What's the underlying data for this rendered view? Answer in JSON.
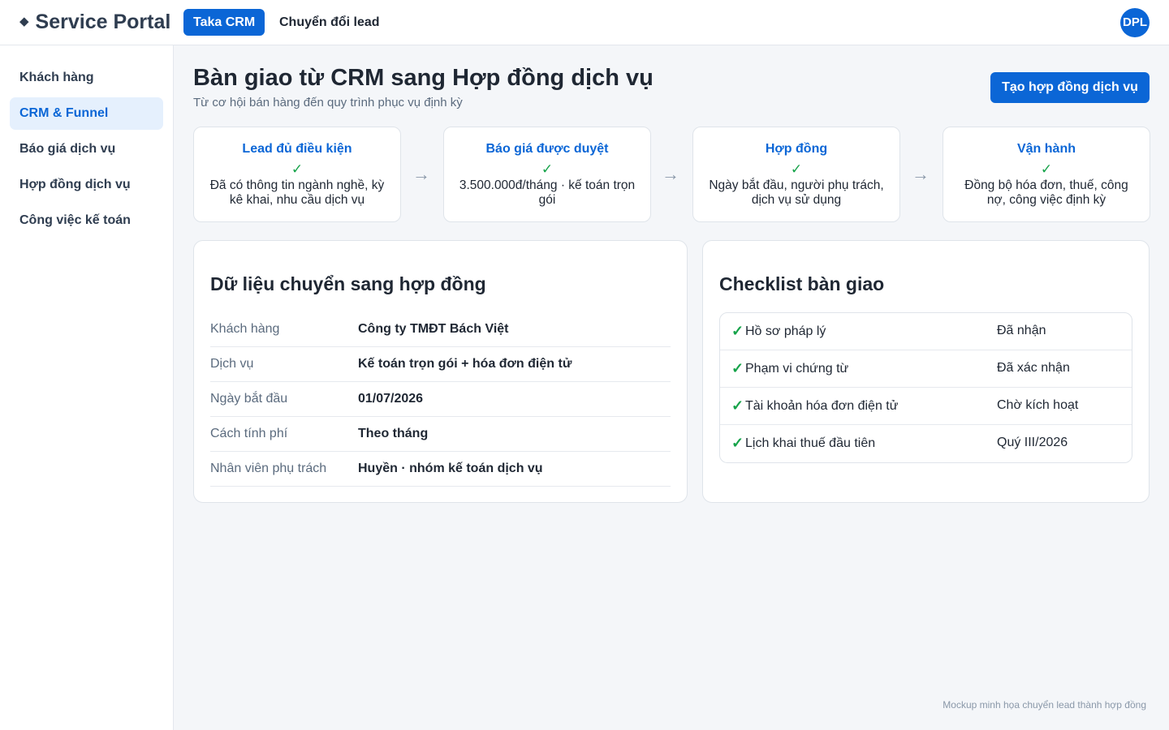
{
  "header": {
    "brand_icon": "diamond-icon",
    "brand_name": "Service Portal",
    "tabs": [
      {
        "label": "Taka CRM",
        "active": true
      },
      {
        "label": "Chuyển đổi lead",
        "active": false
      }
    ],
    "avatar_initials": "DPL"
  },
  "sidebar": {
    "items": [
      {
        "label": "Khách hàng",
        "active": false
      },
      {
        "label": "CRM & Funnel",
        "active": true
      },
      {
        "label": "Báo giá dịch vụ",
        "active": false
      },
      {
        "label": "Hợp đồng dịch vụ",
        "active": false
      },
      {
        "label": "Công việc kế toán",
        "active": false
      }
    ]
  },
  "main": {
    "title": "Bàn giao từ CRM sang Hợp đồng dịch vụ",
    "subtitle": "Từ cơ hội bán hàng đến quy trình phục vụ định kỳ",
    "primary_button": "Tạo hợp đồng dịch vụ",
    "steps": [
      {
        "title": "Lead đủ điều kiện",
        "check": "✓",
        "desc": "Đã có thông tin ngành nghề, kỳ kê khai, nhu cầu dịch vụ"
      },
      {
        "title": "Báo giá được duyệt",
        "check": "✓",
        "desc": "3.500.000đ/tháng · kế toán trọn gói"
      },
      {
        "title": "Hợp đồng",
        "check": "✓",
        "desc": "Ngày bắt đầu, người phụ trách, dịch vụ sử dụng"
      },
      {
        "title": "Vận hành",
        "check": "✓",
        "desc": "Đồng bộ hóa đơn, thuế, công nợ, công việc định kỳ"
      }
    ],
    "arrow": "→",
    "transfer_card": {
      "title": "Dữ liệu chuyển sang hợp đồng",
      "rows": [
        {
          "label": "Khách hàng",
          "value": "Công ty TMĐT Bách Việt"
        },
        {
          "label": "Dịch vụ",
          "value": "Kế toán trọn gói + hóa đơn điện tử"
        },
        {
          "label": "Ngày bắt đầu",
          "value": "01/07/2026"
        },
        {
          "label": "Cách tính phí",
          "value": "Theo tháng"
        },
        {
          "label": "Nhân viên phụ trách",
          "value": "Huyền · nhóm kế toán dịch vụ"
        }
      ]
    },
    "checklist_card": {
      "title": "Checklist bàn giao",
      "check_mark": "✓",
      "items": [
        {
          "label": "Hồ sơ pháp lý",
          "status": "Đã nhận"
        },
        {
          "label": "Phạm vi chứng từ",
          "status": "Đã xác nhận"
        },
        {
          "label": "Tài khoản hóa đơn điện tử",
          "status": "Chờ kích hoạt"
        },
        {
          "label": "Lịch khai thuế đầu tiên",
          "status": "Quý III/2026"
        }
      ]
    },
    "footnote": "Mockup minh họa chuyển lead thành hợp đồng"
  },
  "colors": {
    "accent": "#0b66d6",
    "success": "#16a34a",
    "active_bg": "#e5f0fd"
  }
}
